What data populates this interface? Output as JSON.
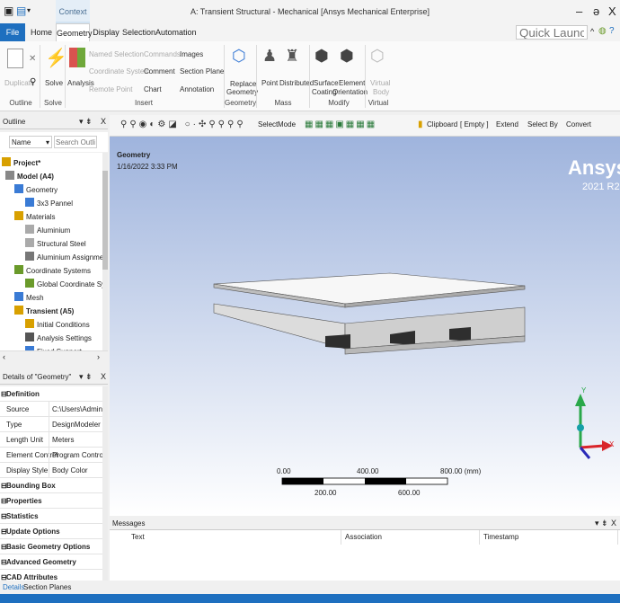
{
  "title_bar": {
    "title": "A: Transient Structural - Mechanical [Ansys Mechanical Enterprise]",
    "context_tab": "Context",
    "minimize": "–",
    "restore": "ə",
    "close": "X"
  },
  "tabs": [
    {
      "label": "File"
    },
    {
      "label": "Home"
    },
    {
      "label": "Geometry"
    },
    {
      "label": "Display"
    },
    {
      "label": "Selection"
    },
    {
      "label": "Automation"
    }
  ],
  "quick_launch": {
    "placeholder": "Quick Launch"
  },
  "ribbon": {
    "outline": {
      "duplicate": "Duplicate",
      "group": "Outline"
    },
    "solve": {
      "solve": "Solve",
      "group": "Solve"
    },
    "insert": {
      "analysis": "Analysis",
      "named_selection": "Named Selection",
      "coordinate_system": "Coordinate System",
      "remote_point": "Remote Point",
      "commands": "Commands",
      "comment": "Comment",
      "chart": "Chart",
      "images": "Images",
      "section_plane": "Section Plane",
      "annotation": "Annotation",
      "group": "Insert"
    },
    "geometry": {
      "replace": "Replace",
      "replace2": "Geometry",
      "group": "Geometry"
    },
    "mass": {
      "point": "Point",
      "distributed": "Distributed",
      "group": "Mass"
    },
    "modify": {
      "surface": "Surface",
      "coating": "Coating",
      "element": "Element",
      "orientation": "Orientation",
      "group": "Modify"
    },
    "virtual": {
      "virtual": "Virtual",
      "body": "Body",
      "group": "Virtual"
    }
  },
  "outline": {
    "title": "Outline",
    "name_label": "Name",
    "search_placeholder": "Search Outline"
  },
  "tree": [
    {
      "label": "Project*",
      "bold": true
    },
    {
      "label": "Model (A4)",
      "bold": true
    },
    {
      "label": "Geometry",
      "bold": false
    },
    {
      "label": "3x3 Pannel",
      "bold": false
    },
    {
      "label": "Materials",
      "bold": false
    },
    {
      "label": "Aluminium",
      "bold": false
    },
    {
      "label": "Structural Steel",
      "bold": false
    },
    {
      "label": "Aluminium Assignment",
      "bold": false
    },
    {
      "label": "Coordinate Systems",
      "bold": false
    },
    {
      "label": "Global Coordinate System",
      "bold": false
    },
    {
      "label": "Mesh",
      "bold": false
    },
    {
      "label": "Transient (A5)",
      "bold": true
    },
    {
      "label": "Initial Conditions",
      "bold": false
    },
    {
      "label": "Analysis Settings",
      "bold": false
    },
    {
      "label": "Fixed Support",
      "bold": false
    }
  ],
  "details": {
    "title": "Details of \"Geometry\"",
    "rows": [
      {
        "key": "Definition",
        "value": "",
        "section": true
      },
      {
        "key": "Source",
        "value": "C:\\Users\\Admin\\Des...",
        "section": false
      },
      {
        "key": "Type",
        "value": "DesignModeler",
        "section": false
      },
      {
        "key": "Length Unit",
        "value": "Meters",
        "section": false
      },
      {
        "key": "Element Control",
        "value": "Program Controlled",
        "section": false
      },
      {
        "key": "Display Style",
        "value": "Body Color",
        "section": false
      },
      {
        "key": "Bounding Box",
        "value": "",
        "section": true
      },
      {
        "key": "Properties",
        "value": "",
        "section": true
      },
      {
        "key": "Statistics",
        "value": "",
        "section": true
      },
      {
        "key": "Update Options",
        "value": "",
        "section": true
      },
      {
        "key": "Basic Geometry Options",
        "value": "",
        "section": true
      },
      {
        "key": "Advanced Geometry Options",
        "value": "",
        "section": true
      },
      {
        "key": "CAD Attributes",
        "value": "",
        "section": true
      }
    ]
  },
  "bottom_tabs": {
    "details": "Details",
    "section_planes": "Section Planes"
  },
  "toolbar": {
    "select": "Select",
    "mode": "Mode",
    "clipboard": "Clipboard",
    "empty": "[ Empty ]",
    "extend": "Extend",
    "select_by": "Select By",
    "convert": "Convert"
  },
  "viewport": {
    "label": "Geometry",
    "timestamp": "1/16/2022 3:33 PM",
    "brand": "Ansys",
    "version": "2021 R2",
    "scale_top": [
      "0.00",
      "400.00",
      "800.00 (mm)"
    ],
    "scale_bottom": [
      "200.00",
      "600.00"
    ],
    "axis_y": "Y",
    "axis_x": "X"
  },
  "messages": {
    "title": "Messages",
    "columns": [
      "Text",
      "Association",
      "Timestamp"
    ]
  },
  "colors": {
    "accent": "#1e6fbf",
    "viewport_top": "#9fb4dd",
    "body": "#cfcfcf"
  }
}
